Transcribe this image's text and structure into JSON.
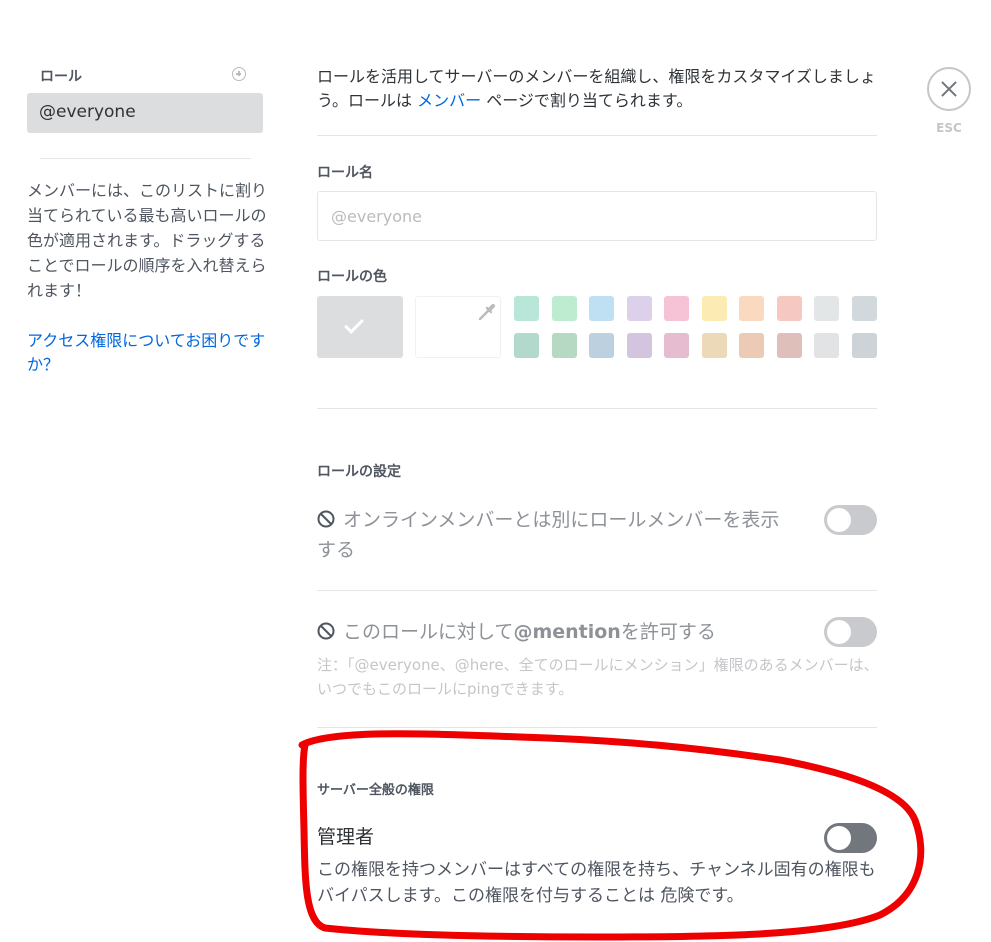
{
  "sidebar": {
    "header": "ロール",
    "add_icon": "plus-circle-icon",
    "items": [
      {
        "label": "@everyone",
        "selected": true
      }
    ],
    "description": "メンバーには、このリストに割り当てられている最も高いロールの色が適用されます。ドラッグすることでロールの順序を入れ替えられます！",
    "help_link": "アクセス権限についてお困りですか？"
  },
  "close": {
    "icon": "close-icon",
    "label": "ESC"
  },
  "intro": {
    "text_before": "ロールを活用してサーバーのメンバーを組織し、権限をカスタマイズしましょう。ロールは",
    "link": "メンバー",
    "text_after": "ページで割り当てられます。"
  },
  "role_name": {
    "label": "ロール名",
    "placeholder": "@everyone"
  },
  "role_color": {
    "label": "ロールの色",
    "default_icon": "check-icon",
    "custom_icon": "eyedropper-icon",
    "swatches_row1": [
      "#b8e6d8",
      "#bdecd0",
      "#bfdff3",
      "#ddd0ea",
      "#f6c3d6",
      "#fcebb2",
      "#fad9c1",
      "#f5c8c2",
      "#e3e6e7",
      "#d2d9dd"
    ],
    "swatches_row2": [
      "#b3d8cc",
      "#b5d9c3",
      "#bcd0df",
      "#d3c4df",
      "#e5bcd0",
      "#ecd9b8",
      "#ebcbb6",
      "#dfbfba",
      "#e1e3e5",
      "#cdd3d7"
    ],
    "default_color": "#dcddde"
  },
  "role_settings": {
    "label": "ロールの設定",
    "display_separately": {
      "icon": "ban-icon",
      "label": "オンラインメンバーとは別にロールメンバーを表示する",
      "enabled": false
    },
    "mentionable": {
      "icon": "ban-icon",
      "label_before": "このロールに対して",
      "label_bold": "@mention",
      "label_after": "を許可する",
      "enabled": false,
      "note": "注：「@everyone、@here、全てのロールにメンション」権限のあるメンバーは、いつでもこのロールにpingできます。"
    }
  },
  "general_permissions": {
    "label": "サーバー全般の権限",
    "administrator": {
      "title": "管理者",
      "description": "この権限を持つメンバーはすべての権限を持ち、チャンネル固有の権限もバイパスします。この権限を付与することは 危険です。",
      "enabled": false
    }
  },
  "annotation": {
    "color": "#ff0000"
  }
}
